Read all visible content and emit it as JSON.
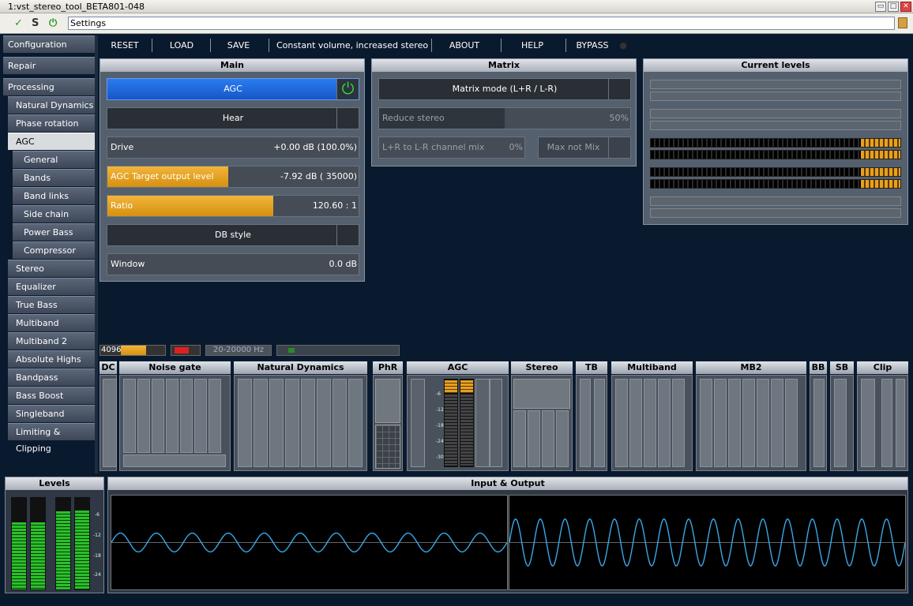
{
  "window": {
    "title": "1:vst_stereo_tool_BETA801-048"
  },
  "address": {
    "value": "Settings",
    "btn_check": "✓",
    "btn_s": "S",
    "btn_power": "⏻"
  },
  "sidebar": {
    "items": [
      {
        "label": "Configuration",
        "level": 1,
        "selected": false
      },
      {
        "label": "Repair",
        "level": 1,
        "selected": false
      },
      {
        "label": "Processing",
        "level": 1,
        "selected": false
      },
      {
        "label": "Natural Dynamics",
        "level": 2,
        "selected": false
      },
      {
        "label": "Phase rotation",
        "level": 2,
        "selected": false
      },
      {
        "label": "AGC",
        "level": 2,
        "selected": true
      },
      {
        "label": "General",
        "level": 3,
        "selected": false
      },
      {
        "label": "Bands",
        "level": 3,
        "selected": false
      },
      {
        "label": "Band links",
        "level": 3,
        "selected": false
      },
      {
        "label": "Side chain",
        "level": 3,
        "selected": false
      },
      {
        "label": "Power Bass",
        "level": 3,
        "selected": false
      },
      {
        "label": "Compressor",
        "level": 3,
        "selected": false
      },
      {
        "label": "Stereo",
        "level": 2,
        "selected": false
      },
      {
        "label": "Equalizer",
        "level": 2,
        "selected": false
      },
      {
        "label": "True Bass",
        "level": 2,
        "selected": false
      },
      {
        "label": "Multiband",
        "level": 2,
        "selected": false
      },
      {
        "label": "Multiband 2",
        "level": 2,
        "selected": false
      },
      {
        "label": "Absolute Highs",
        "level": 2,
        "selected": false
      },
      {
        "label": "Bandpass",
        "level": 2,
        "selected": false
      },
      {
        "label": "Bass Boost",
        "level": 2,
        "selected": false
      },
      {
        "label": "Singleband",
        "level": 2,
        "selected": false
      },
      {
        "label": "Limiting & Clipping",
        "level": 2,
        "selected": false
      }
    ]
  },
  "toolbar": {
    "reset": "RESET",
    "load": "LOAD",
    "save": "SAVE",
    "preset": "Constant volume, increased stereo",
    "about": "ABOUT",
    "help": "HELP",
    "bypass": "BYPASS"
  },
  "main": {
    "title": "Main",
    "agc_label": "AGC",
    "agc_on": true,
    "hear_label": "Hear",
    "drive": {
      "label": "Drive",
      "value": "+0.00 dB (100.0%)",
      "fill": 0
    },
    "target": {
      "label": "AGC Target output level",
      "value": "-7.92 dB ( 35000)",
      "fill": 0.48
    },
    "ratio": {
      "label": "Ratio",
      "value": "120.60 : 1",
      "fill": 0.66
    },
    "dbstyle_label": "DB style",
    "window": {
      "label": "Window",
      "value": "0.0 dB",
      "fill": 0
    }
  },
  "matrix": {
    "title": "Matrix",
    "mode_label": "Matrix mode (L+R / L-R)",
    "reduce": {
      "label": "Reduce stereo",
      "value": "50%",
      "fill": 0.5
    },
    "mix": {
      "label": "L+R to L-R channel mix",
      "value": "0%",
      "fill": 0
    },
    "max_label": "Max not Mix"
  },
  "levels_panel": {
    "title": "Current levels"
  },
  "status": {
    "size": "4096",
    "size_fill": 0.55,
    "freq": "20-20000 Hz"
  },
  "modules": [
    {
      "label": "DC"
    },
    {
      "label": "Noise gate"
    },
    {
      "label": "Natural Dynamics"
    },
    {
      "label": "PhR"
    },
    {
      "label": "AGC"
    },
    {
      "label": "Stereo"
    },
    {
      "label": "TB"
    },
    {
      "label": "Multiband"
    },
    {
      "label": "MB2"
    },
    {
      "label": "BB"
    },
    {
      "label": "SB"
    },
    {
      "label": "Clip"
    }
  ],
  "agc_ticks": [
    "-6",
    "-12",
    "-18",
    "-24",
    "-30"
  ],
  "bottom_levels": {
    "title": "Levels",
    "ticks": [
      "-6",
      "-12",
      "-18",
      "-24"
    ],
    "channel_levels": [
      0.73,
      0.73,
      0.85,
      0.86
    ]
  },
  "io": {
    "title": "Input & Output",
    "input_cycles": 11,
    "input_amp": 0.2,
    "output_cycles": 16,
    "output_amp": 0.5
  },
  "colors": {
    "accent": "#1e6be0",
    "orange": "#e8a020",
    "power_green": "#3ad03a",
    "wave": "#3aa8e8"
  }
}
